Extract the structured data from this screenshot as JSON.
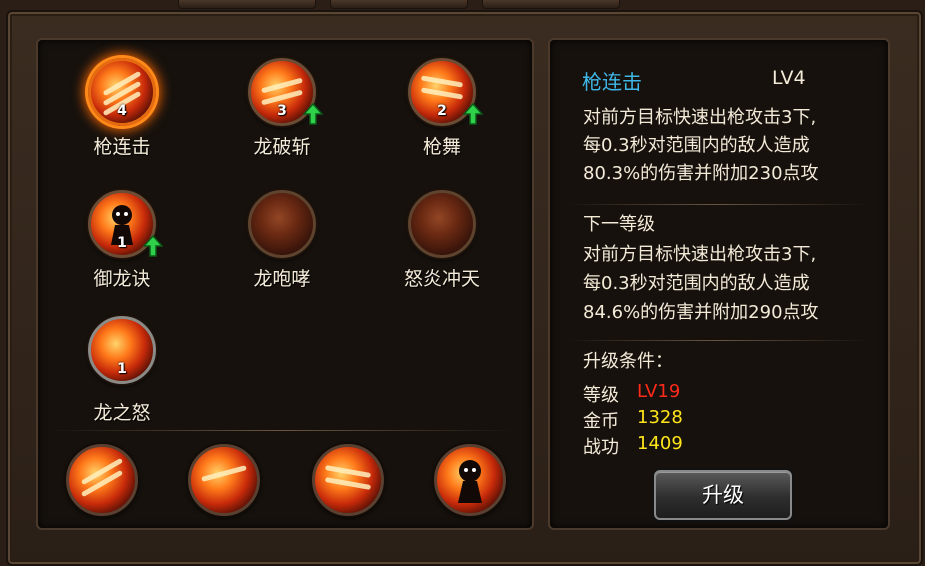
{
  "skills": [
    {
      "name": "枪连击",
      "level": "4",
      "upgradable": false,
      "selected": true,
      "locked": false
    },
    {
      "name": "龙破斩",
      "level": "3",
      "upgradable": true,
      "selected": false,
      "locked": false
    },
    {
      "name": "枪舞",
      "level": "2",
      "upgradable": true,
      "selected": false,
      "locked": false
    },
    {
      "name": "御龙诀",
      "level": "1",
      "upgradable": true,
      "selected": false,
      "locked": false
    },
    {
      "name": "龙咆哮",
      "level": "",
      "upgradable": false,
      "selected": false,
      "locked": true
    },
    {
      "name": "怒炎冲天",
      "level": "",
      "upgradable": false,
      "selected": false,
      "locked": true
    },
    {
      "name": "龙之怒",
      "level": "1",
      "upgradable": false,
      "selected": false,
      "locked": false
    }
  ],
  "equipped_slots": [
    "枪连击",
    "龙破斩",
    "枪舞",
    "御龙诀"
  ],
  "detail": {
    "title": "枪连击",
    "level": "LV4",
    "current_desc": [
      "对前方目标快速出枪攻击3下,",
      "每0.3秒对范围内的敌人造成",
      "80.3%的伤害并附加230点攻"
    ],
    "next_label": "下一等级",
    "next_desc": [
      "对前方目标快速出枪攻击3下,",
      "每0.3秒对范围内的敌人造成",
      "84.6%的伤害并附加290点攻"
    ],
    "cond_title": "升级条件：",
    "conditions": [
      {
        "label": "等级",
        "value": "LV19",
        "color": "#ff2a1a"
      },
      {
        "label": "金币",
        "value": "1328",
        "color": "#ffe61a"
      },
      {
        "label": "战功",
        "value": "1409",
        "color": "#ffe61a"
      }
    ],
    "upgrade_label": "升级"
  }
}
